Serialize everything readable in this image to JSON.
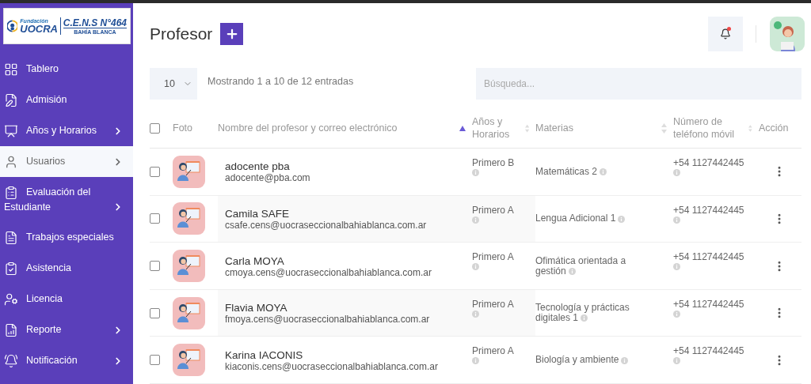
{
  "logo": {
    "foundation_small": "Fundación",
    "foundation": "UOCRA",
    "school": "C.E.N.S N°464",
    "city": "BAHÍA BLANCA"
  },
  "sidebar": {
    "items": [
      {
        "label": "Tablero",
        "selected": false,
        "expandable": false
      },
      {
        "label": "Admisión",
        "selected": false,
        "expandable": false
      },
      {
        "label": "Años y Horarios",
        "selected": false,
        "expandable": true
      },
      {
        "label": "Usuarios",
        "selected": true,
        "expandable": true
      },
      {
        "label": "Evaluación del Estudiante",
        "selected": false,
        "expandable": true
      },
      {
        "label": "Trabajos especiales",
        "selected": false,
        "expandable": false
      },
      {
        "label": "Asistencia",
        "selected": false,
        "expandable": false
      },
      {
        "label": "Licencia",
        "selected": false,
        "expandable": false
      },
      {
        "label": "Reporte",
        "selected": false,
        "expandable": true
      },
      {
        "label": "Notificación",
        "selected": false,
        "expandable": true
      }
    ]
  },
  "header": {
    "title": "Profesor",
    "notifications_unread": true
  },
  "table_controls": {
    "page_size": "10",
    "info": "Mostrando 1 a 10 de 12 entradas",
    "search_placeholder": "Búsqueda..."
  },
  "table": {
    "columns": [
      {
        "kind": "checkbox"
      },
      {
        "label": "Foto",
        "kind": "text"
      },
      {
        "label": "Nombre del profesor y correo electrónico",
        "kind": "text",
        "sortable": true,
        "sorted": true
      },
      {
        "label": "Años y Horarios",
        "kind": "text",
        "sortable": true,
        "sorted": false
      },
      {
        "label": "Materias",
        "kind": "text",
        "sortable": true,
        "sorted": false
      },
      {
        "label": "Número de teléfono móvil",
        "kind": "text",
        "sortable": true,
        "sorted": false
      },
      {
        "label": "Acción",
        "kind": "text"
      }
    ],
    "header_checked": false,
    "rows": [
      {
        "checked": false,
        "name": "adocente pba",
        "email": "adocente@pba.com",
        "year": "Primero B",
        "subject": "Matemáticas 2",
        "phone": "+54 1127442445"
      },
      {
        "checked": false,
        "name": "Camila SAFE",
        "email": "csafe.cens@uocraseccionalbahiablanca.com.ar",
        "year": "Primero A",
        "subject": "Lengua Adicional 1",
        "phone": "+54 1127442445"
      },
      {
        "checked": false,
        "name": "Carla MOYA",
        "email": "cmoya.cens@uocraseccionalbahiablanca.com.ar",
        "year": "Primero A",
        "subject": "Ofimática orientada a gestión",
        "phone": "+54 1127442445"
      },
      {
        "checked": false,
        "name": "Flavia MOYA",
        "email": "fmoya.cens@uocraseccionalbahiablanca.com.ar",
        "year": "Primero A",
        "subject": "Tecnología y prácticas digitales 1",
        "phone": "+54 1127442445"
      },
      {
        "checked": false,
        "name": "Karina IACONIS",
        "email": "kiaconis.cens@uocraseccionalbahiablanca.com.ar",
        "year": "Primero A",
        "subject": "Biología y ambiente",
        "phone": "+54 1127442445"
      }
    ]
  }
}
